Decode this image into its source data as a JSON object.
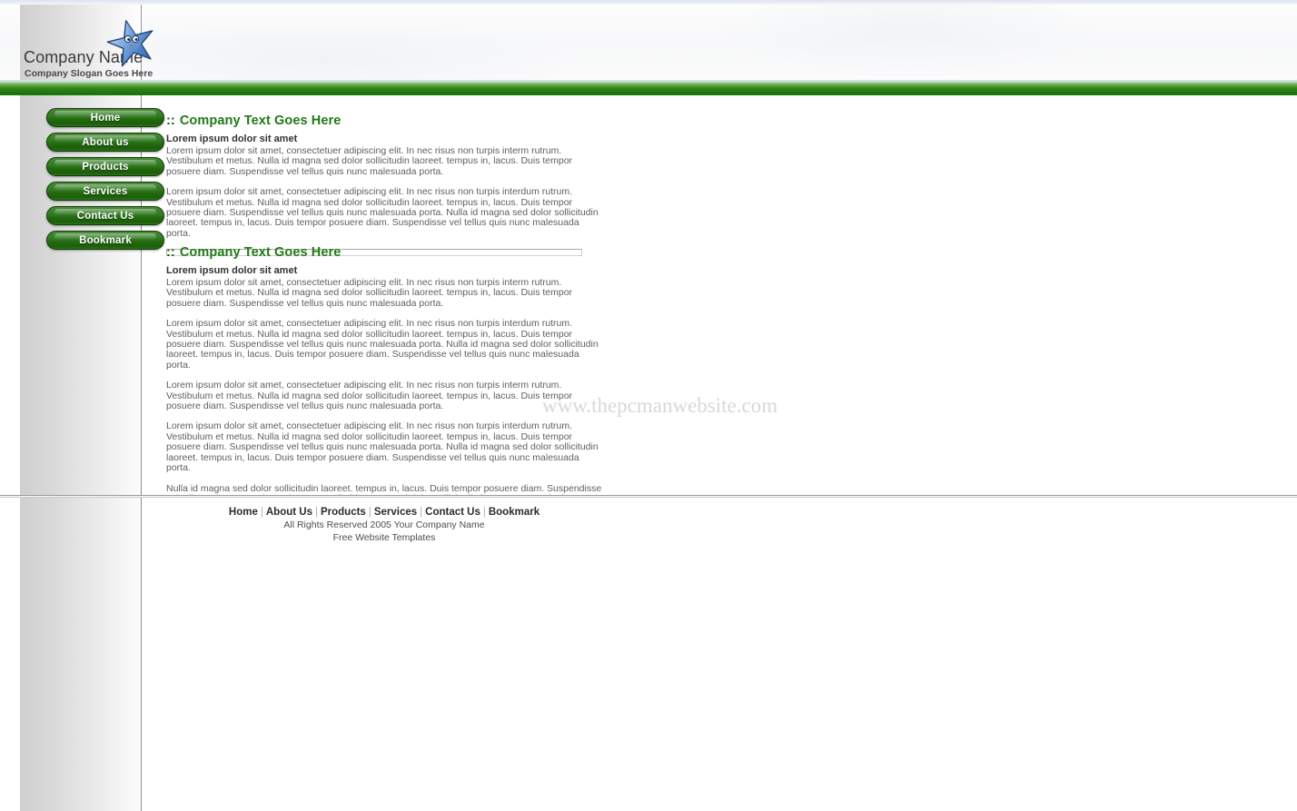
{
  "header": {
    "company_name": "Company Name",
    "company_slogan": "Company Slogan Goes Here",
    "logo_icon": "blue-cartoon-star-icon"
  },
  "sidebar": {
    "items": [
      {
        "label": "Home"
      },
      {
        "label": "About us"
      },
      {
        "label": "Products"
      },
      {
        "label": "Services"
      },
      {
        "label": "Contact Us"
      },
      {
        "label": "Bookmark"
      }
    ]
  },
  "content": {
    "sections": [
      {
        "dots": "::",
        "heading": "Company Text Goes Here",
        "subheading": "Lorem ipsum dolor sit amet",
        "paragraphs": [
          "Lorem ipsum dolor sit amet, consectetuer adipiscing elit. In nec risus non turpis interm rutrum. Vestibulum et metus. Nulla id magna sed dolor sollicitudin laoreet. tempus in, lacus. Duis tempor posuere diam. Suspendisse vel tellus quis nunc malesuada porta.",
          "Lorem ipsum dolor sit amet, consectetuer adipiscing elit. In nec risus non turpis interdum rutrum. Vestibulum et metus. Nulla id magna sed dolor sollicitudin laoreet. tempus in, lacus. Duis tempor posuere diam. Suspendisse vel tellus quis nunc malesuada porta. Nulla id magna sed dolor sollicitudin laoreet. tempus in, lacus. Duis tempor posuere diam. Suspendisse vel tellus quis nunc malesuada porta."
        ]
      },
      {
        "dots": "::",
        "heading": "Company Text Goes Here",
        "subheading": "Lorem ipsum dolor sit amet",
        "paragraphs": [
          "Lorem ipsum dolor sit amet, consectetuer adipiscing elit. In nec risus non turpis interm rutrum. Vestibulum et metus. Nulla id magna sed dolor sollicitudin laoreet. tempus in, lacus. Duis tempor posuere diam. Suspendisse vel tellus quis nunc malesuada porta.",
          "Lorem ipsum dolor sit amet, consectetuer adipiscing elit. In nec risus non turpis interdum rutrum. Vestibulum et metus. Nulla id magna sed dolor sollicitudin laoreet. tempus in, lacus. Duis tempor posuere diam. Suspendisse vel tellus quis nunc malesuada porta. Nulla id magna sed dolor sollicitudin laoreet. tempus in, lacus. Duis tempor posuere diam. Suspendisse vel tellus quis nunc malesuada porta.",
          "Lorem ipsum dolor sit amet, consectetuer adipiscing elit. In nec risus non turpis interm rutrum. Vestibulum et metus. Nulla id magna sed dolor sollicitudin laoreet. tempus in, lacus. Duis tempor posuere diam. Suspendisse vel tellus quis nunc malesuada porta.",
          "Lorem ipsum dolor sit amet, consectetuer adipiscing elit. In nec risus non turpis interdum rutrum. Vestibulum et metus. Nulla id magna sed dolor sollicitudin laoreet. tempus in, lacus. Duis tempor posuere diam. Suspendisse vel tellus quis nunc malesuada porta. Nulla id magna sed dolor sollicitudin laoreet. tempus in, lacus. Duis tempor posuere diam. Suspendisse vel tellus quis nunc malesuada porta.",
          "Nulla id magna sed dolor sollicitudin laoreet. tempus in, lacus. Duis tempor posuere diam. Suspendisse vel tellus quis nunc malesuada porta. Nulla id magna sed dolor sollicitudin laoreet. tempus in, lacus. Duis tempor posuere diam. Suspendisse vel tellus quis nunc malesuada porta."
        ]
      }
    ]
  },
  "watermark": {
    "text": "www.thepcmanwebsite.com"
  },
  "footer": {
    "links": [
      {
        "label": "Home"
      },
      {
        "label": "About Us"
      },
      {
        "label": "Products"
      },
      {
        "label": "Services"
      },
      {
        "label": "Contact Us"
      },
      {
        "label": "Bookmark"
      }
    ],
    "separator": "|",
    "copyright": "All Rights Reserved 2005 Your Company Name",
    "credit": "Free Website Templates"
  },
  "colors": {
    "brand_green": "#1f7a16",
    "bar_green": "#2f8413",
    "body_text": "#5e6066",
    "heading_dots": "#145a0d"
  }
}
